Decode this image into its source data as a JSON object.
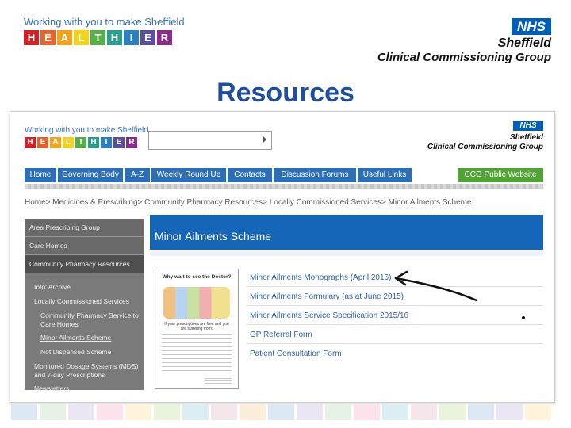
{
  "slide": {
    "title": "Resources"
  },
  "brand": {
    "tagline": "Working with you to make Sheffield",
    "letters": [
      "H",
      "E",
      "A",
      "L",
      "T",
      "H",
      "I",
      "E",
      "R"
    ],
    "letter_colors": [
      "#d62027",
      "#e8632b",
      "#f4a21c",
      "#f2d31b",
      "#55b048",
      "#2b9e8f",
      "#2a7fc1",
      "#5a4ea0",
      "#8b2b8c"
    ],
    "nhs": "NHS",
    "org_line1": "Sheffield",
    "org_line2": "Clinical Commissioning Group"
  },
  "screenshot": {
    "nav": [
      "Home",
      "Governing Body",
      "A-Z",
      "Weekly Round Up",
      "Contacts",
      "Discussion Forums",
      "Useful Links"
    ],
    "nav_right": "CCG Public Website",
    "breadcrumb": "Home> Medicines & Prescribing> Community Pharmacy Resources> Locally Commissioned Services> Minor Ailments Scheme",
    "sidebar": {
      "area": "Area Prescribing Group",
      "care_homes": "Care Homes",
      "cpr": "Community Pharmacy Resources",
      "info_archive": "Info' Archive",
      "lcs": "Locally Commissioned Services",
      "cps_line1": "Community Pharmacy Service to",
      "cps_line2": "Care Homes",
      "mas": "Minor Ailments Scheme",
      "nds": "Not Dispensed Scheme",
      "mds_line1": "Monitored Dosage Systems (MDS)",
      "mds_line2": "and 7-day Prescriptions",
      "newsletters": "Newsletters"
    },
    "content_title": "Minor Ailments Scheme",
    "links": [
      "Minor Ailments Monographs (April 2016)",
      "Minor Ailments Formulary (as at June 2015)",
      "Minor Ailments Service Specification 2015/16",
      "GP Referral Form",
      "Patient Consultation Form"
    ],
    "poster": {
      "title": "Why wait to see the Doctor?",
      "subtitle": "If your prescriptions are free and you are suffering from:"
    }
  },
  "footer_colors": [
    "#dce8f4",
    "#e6f2e6",
    "#ece6f4",
    "#fde4ec",
    "#fff3dc",
    "#eaf4dc",
    "#dceef4",
    "#f4e6ea",
    "#fdeedc",
    "#dce8f4",
    "#ece6f4",
    "#e6f2e6",
    "#fde4ec",
    "#dceef4",
    "#f4e6ea",
    "#eaf4dc",
    "#dce8f4",
    "#ece6f4",
    "#fff3dc"
  ]
}
